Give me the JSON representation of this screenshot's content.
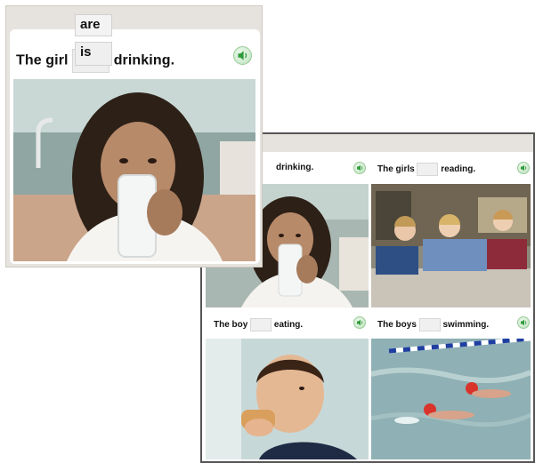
{
  "front_card": {
    "choice_top": "are",
    "choice_bottom": "is",
    "sentence_start": "The girl",
    "sentence_end": "drinking.",
    "audio_icon": "speaker-icon"
  },
  "back_panel": {
    "cells": [
      {
        "sentence_start": "",
        "sentence_end": "drinking.",
        "audio_icon": "speaker-icon"
      },
      {
        "sentence_start": "The girls",
        "sentence_end": "reading.",
        "audio_icon": "speaker-icon"
      },
      {
        "sentence_start": "The boy",
        "sentence_end": "eating.",
        "audio_icon": "speaker-icon"
      },
      {
        "sentence_start": "The boys",
        "sentence_end": "swimming.",
        "audio_icon": "speaker-icon"
      }
    ]
  },
  "colors": {
    "audio_green": "#2e9b3a",
    "card_bg": "#e6e3de",
    "panel_border": "#555555"
  }
}
